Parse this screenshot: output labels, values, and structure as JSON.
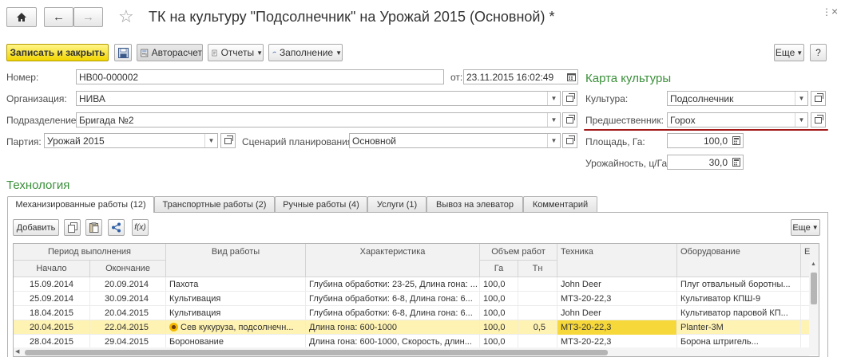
{
  "window": {
    "title": "ТК на культуру \"Подсолнечник\" на Урожай 2015 (Основной) *"
  },
  "toolbar": {
    "save_close": "Записать и закрыть",
    "autocalc": "Авторасчет",
    "reports": "Отчеты",
    "fill": "Заполнение",
    "more": "Еще",
    "help": "?"
  },
  "form": {
    "number_label": "Номер:",
    "number": "НВ00-000002",
    "date_label": "от:",
    "date": "23.11.2015 16:02:49",
    "org_label": "Организация:",
    "org": "НИВА",
    "dept_label": "Подразделение:",
    "dept": "Бригада №2",
    "batch_label": "Партия:",
    "batch": "Урожай 2015",
    "scenario_label": "Сценарий планирования:",
    "scenario": "Основной"
  },
  "crop_card": {
    "title": "Карта культуры",
    "culture_label": "Культура:",
    "culture": "Подсолнечник",
    "predecessor_label": "Предшественник:",
    "predecessor": "Горох",
    "area_label": "Площадь, Га:",
    "area": "100,0",
    "yield_label": "Урожайность, ц/Га:",
    "yield": "30,0"
  },
  "technology": {
    "title": "Технология",
    "tabs": [
      {
        "label": "Механизированные работы (12)"
      },
      {
        "label": "Транспортные работы (2)"
      },
      {
        "label": "Ручные работы (4)"
      },
      {
        "label": "Услуги (1)"
      },
      {
        "label": "Вывоз на элеватор"
      },
      {
        "label": "Комментарий"
      }
    ],
    "add_label": "Добавить",
    "more_label": "Еще"
  },
  "table": {
    "headers": {
      "period": "Период выполнения",
      "start": "Начало",
      "end": "Окончание",
      "work_type": "Вид работы",
      "characteristic": "Характеристика",
      "volume": "Объем работ",
      "ga": "Га",
      "tn": "Тн",
      "machinery": "Техника",
      "equipment": "Оборудование",
      "extra": "Е"
    },
    "rows": [
      {
        "start": "15.09.2014",
        "end": "20.09.2014",
        "work": "Пахота",
        "char": "Глубина обработки: 23-25, Длина гона: ...",
        "ga": "100,0",
        "tn": "",
        "mach": "John Deer",
        "equip": "Плуг отвальный боротны..."
      },
      {
        "start": "25.09.2014",
        "end": "30.09.2014",
        "work": "Культивация",
        "char": "Глубина обработки: 6-8, Длина гона: 6...",
        "ga": "100,0",
        "tn": "",
        "mach": "МТЗ-20-22,3",
        "equip": "Культиватор КПШ-9"
      },
      {
        "start": "18.04.2015",
        "end": "20.04.2015",
        "work": "Культивация",
        "char": "Глубина обработки: 6-8, Длина гона: 6...",
        "ga": "100,0",
        "tn": "",
        "mach": "John Deer",
        "equip": "Культиватор паровой КП..."
      },
      {
        "start": "20.04.2015",
        "end": "22.04.2015",
        "work": "Сев кукуруза, подсолнечн...",
        "char": "Длина гона: 600-1000",
        "ga": "100,0",
        "tn": "0,5",
        "mach": "МТЗ-20-22,3",
        "equip": "Planter-3M"
      },
      {
        "start": "28.04.2015",
        "end": "29.04.2015",
        "work": "Боронование",
        "char": "Длина гона: 600-1000, Скорость, длин...",
        "ga": "100,0",
        "tn": "",
        "mach": "МТЗ-20-22,3",
        "equip": "Борона штригель..."
      }
    ]
  },
  "colors": {
    "accent_green": "#3a8f3a",
    "primary_yellow": "#f2d500",
    "selected_row": "#fff3b3",
    "underline_red": "#a31919"
  }
}
